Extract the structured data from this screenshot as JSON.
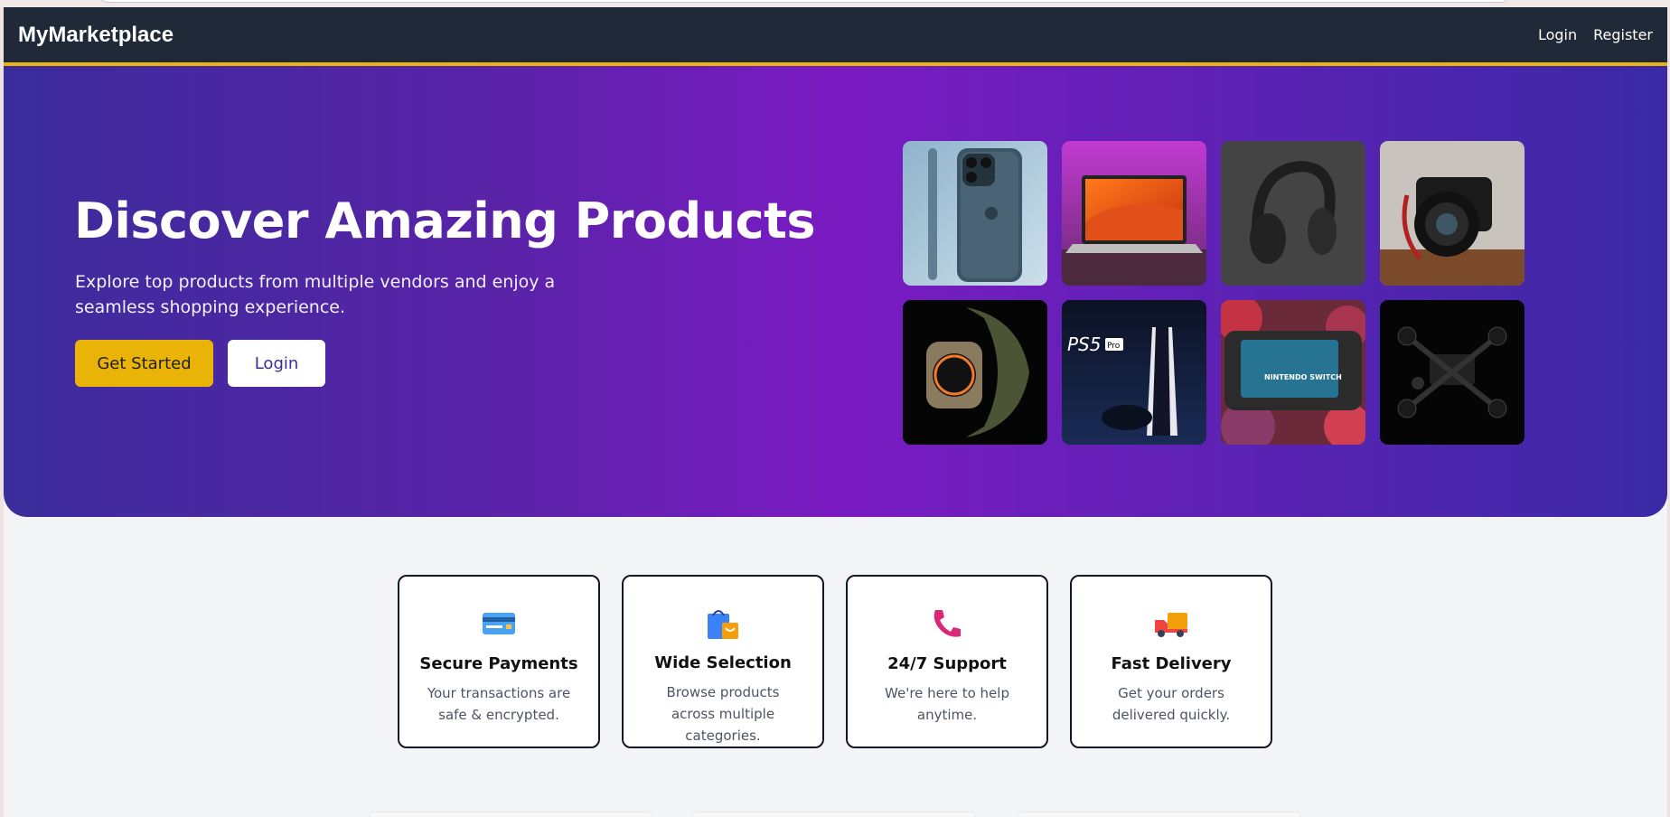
{
  "nav": {
    "brand": "MyMarketplace",
    "login": "Login",
    "register": "Register"
  },
  "hero": {
    "title": "Discover Amazing Products",
    "subtitle": "Explore top products from multiple vendors and enjoy a seamless shopping experience.",
    "cta_primary": "Get Started",
    "cta_secondary": "Login",
    "products": [
      {
        "name": "smartphone",
        "icon": "iphone-image"
      },
      {
        "name": "laptop",
        "icon": "laptop-image"
      },
      {
        "name": "headphones",
        "icon": "headphones-image"
      },
      {
        "name": "camera",
        "icon": "camera-image"
      },
      {
        "name": "smartwatch",
        "icon": "watch-image"
      },
      {
        "name": "game-console",
        "icon": "ps5-image"
      },
      {
        "name": "handheld-console",
        "icon": "switch-image"
      },
      {
        "name": "drone",
        "icon": "drone-image"
      }
    ],
    "ps5_logo": "PS5",
    "ps5_badge": "Pro",
    "switch_logo": "NINTENDO SWITCH"
  },
  "features": [
    {
      "icon": "credit-card-icon",
      "title": "Secure Payments",
      "desc": "Your transactions are safe & encrypted."
    },
    {
      "icon": "shopping-bags-icon",
      "title": "Wide Selection",
      "desc": "Browse products across multiple categories."
    },
    {
      "icon": "telephone-icon",
      "title": "24/7 Support",
      "desc": "We're here to help anytime."
    },
    {
      "icon": "delivery-truck-icon",
      "title": "Fast Delivery",
      "desc": "Get your orders delivered quickly."
    }
  ],
  "colors": {
    "navbar": "#1f2937",
    "accent": "#eab308",
    "hero_gradient_start": "#3b2c9c",
    "hero_gradient_mid": "#7a1bc2"
  }
}
